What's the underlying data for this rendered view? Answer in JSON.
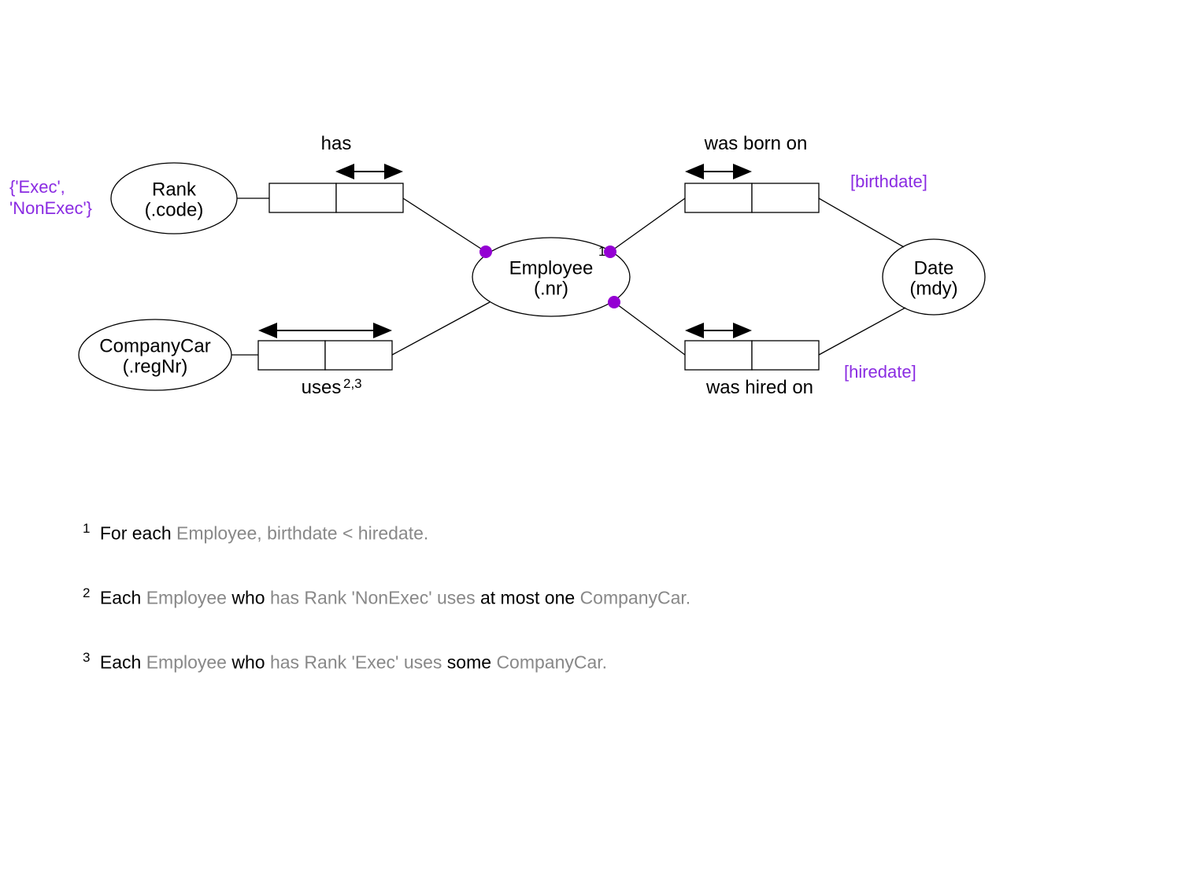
{
  "entities": {
    "rank": {
      "line1": "Rank",
      "line2": "(.code)"
    },
    "companycar": {
      "line1": "CompanyCar",
      "line2": "(.regNr)"
    },
    "employee": {
      "line1": "Employee",
      "line2": "(.nr)",
      "sup": "1"
    },
    "date": {
      "line1": "Date",
      "line2": "(mdy)"
    }
  },
  "predicates": {
    "has": "has",
    "uses": "uses",
    "uses_sup": "2,3",
    "born": "was born on",
    "hired": "was hired on"
  },
  "annotations": {
    "rank_values": "{'Exec', 'NonExec'}",
    "birthdate": "[birthdate]",
    "hiredate": "[hiredate]"
  },
  "footnotes": {
    "f1": {
      "num": "1",
      "pre": "For each ",
      "gray1": "Employee, birthdate < hiredate."
    },
    "f2": {
      "num": "2",
      "pre": "Each ",
      "gray1": "Employee ",
      "mid1": "who ",
      "gray2": "has Rank 'NonExec' uses ",
      "mid2": "at most one ",
      "gray3": "CompanyCar."
    },
    "f3": {
      "num": "3",
      "pre": "Each ",
      "gray1": "Employee ",
      "mid1": "who ",
      "gray2": "has Rank 'Exec' uses ",
      "mid2": "some ",
      "gray3": "CompanyCar."
    }
  }
}
